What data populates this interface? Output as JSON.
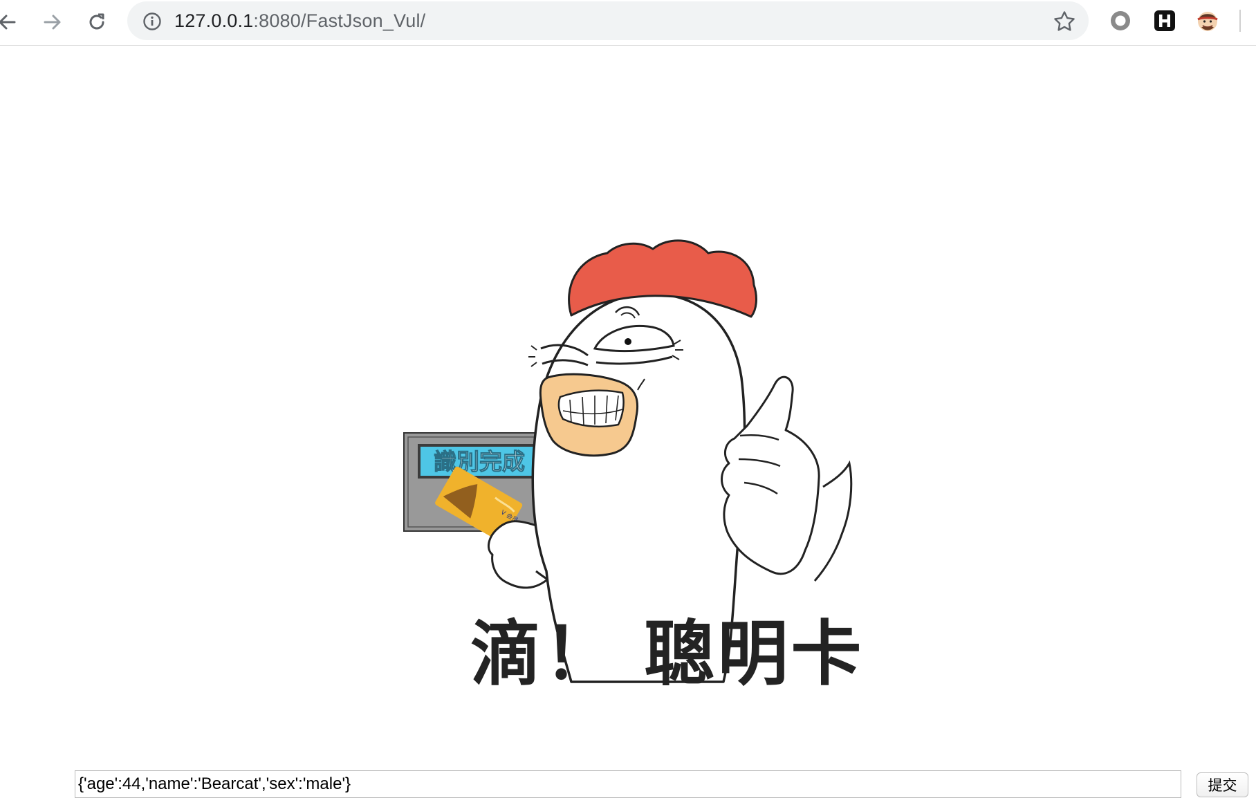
{
  "browser": {
    "url_host": "127.0.0.1",
    "url_path": ":8080/FastJson_Vul/",
    "icons": {
      "back": "back-arrow-icon",
      "forward": "forward-arrow-icon",
      "reload": "reload-icon",
      "site_info": "info-icon",
      "bookmark": "star-icon",
      "extension_1": "circle-extension-icon",
      "extension_2": "h-extension-icon",
      "profile": "profile-avatar-icon"
    }
  },
  "meme": {
    "sign_text": "識別完成",
    "caption": "滴！ 聰明卡",
    "colors": {
      "comb": "#e85c4a",
      "sign": "#4ec6e6",
      "card": "#f0b22c",
      "mouth": "#f6c98f"
    }
  },
  "form": {
    "input_value": "{'age':44,'name':'Bearcat','sex':'male'}",
    "submit_label": "提交"
  }
}
